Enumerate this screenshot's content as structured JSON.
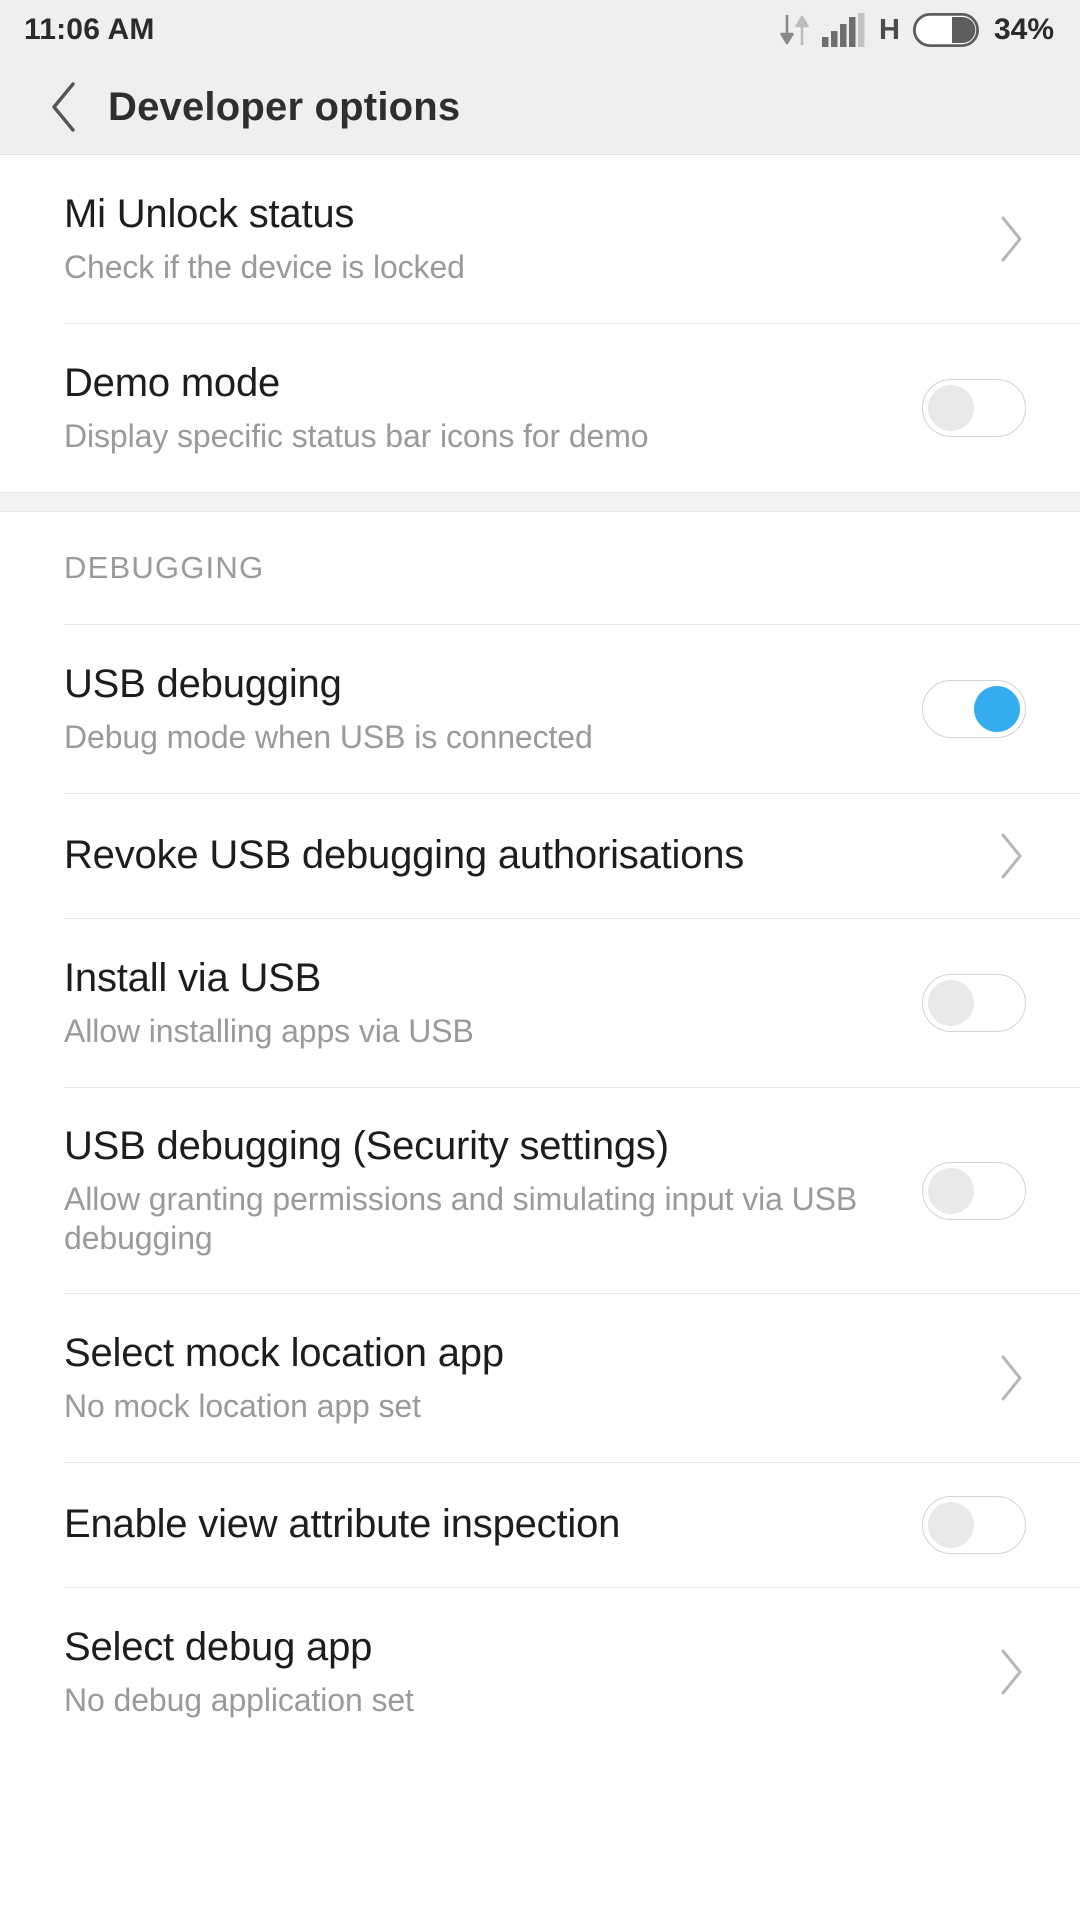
{
  "status_bar": {
    "clock": "11:06 AM",
    "network_type": "H",
    "battery_percent": "34%",
    "icons": [
      "data-transfer-icon",
      "signal-bars-icon",
      "battery-icon"
    ]
  },
  "header": {
    "back_label": "‹",
    "title": "Developer options"
  },
  "colors": {
    "toggle_on": "#35abf0",
    "toggle_off_knob": "#e9e9e9",
    "bar_background": "#efefef",
    "title_text": "#1d1d1d",
    "subtitle_text": "#9a9a9a"
  },
  "sections": [
    {
      "header": null,
      "rows": [
        {
          "title": "Mi Unlock status",
          "subtitle": "Check if the device is locked",
          "accessory": "chevron",
          "name": "row-mi-unlock-status"
        },
        {
          "title": "Demo mode",
          "subtitle": "Display specific status bar icons for demo",
          "accessory": "toggle",
          "toggle_state": "off",
          "name": "row-demo-mode"
        }
      ]
    },
    {
      "header": "DEBUGGING",
      "rows": [
        {
          "title": "USB debugging",
          "subtitle": "Debug mode when USB is connected",
          "accessory": "toggle",
          "toggle_state": "on",
          "name": "row-usb-debugging"
        },
        {
          "title": "Revoke USB debugging authorisations",
          "subtitle": null,
          "accessory": "chevron",
          "name": "row-revoke-usb-debugging-authorisations"
        },
        {
          "title": "Install via USB",
          "subtitle": "Allow installing apps via USB",
          "accessory": "toggle",
          "toggle_state": "off",
          "name": "row-install-via-usb"
        },
        {
          "title": "USB debugging (Security settings)",
          "subtitle": "Allow granting permissions and simulating input via USB debugging",
          "accessory": "toggle",
          "toggle_state": "off",
          "name": "row-usb-debugging-security-settings"
        },
        {
          "title": "Select mock location app",
          "subtitle": "No mock location app set",
          "accessory": "chevron",
          "name": "row-select-mock-location-app"
        },
        {
          "title": "Enable view attribute inspection",
          "subtitle": null,
          "accessory": "toggle",
          "toggle_state": "off",
          "name": "row-enable-view-attribute-inspection"
        },
        {
          "title": "Select debug app",
          "subtitle": "No debug application set",
          "accessory": "chevron",
          "name": "row-select-debug-app"
        }
      ]
    }
  ]
}
